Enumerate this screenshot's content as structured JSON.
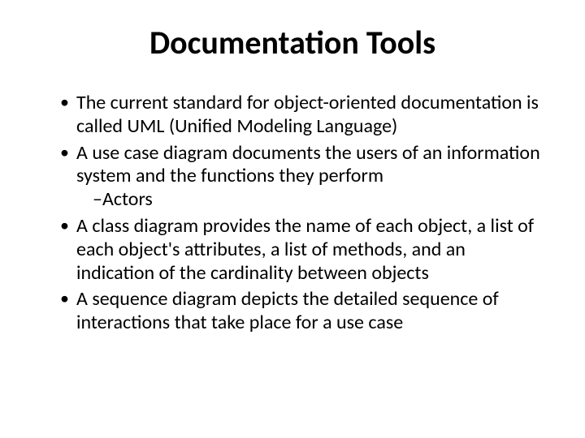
{
  "title": "Documentation Tools",
  "bullets": [
    "The current standard for object-oriented documentation is called UML (Unified Modeling Language)",
    "A use case diagram documents the users of an information system and the functions they perform",
    "A class diagram provides the name of each object, a list of each object's attributes, a list of methods, and an indication of the cardinality between objects",
    "A sequence diagram depicts the detailed sequence of interactions that take place for a use case"
  ],
  "sub_after_1": "Actors"
}
